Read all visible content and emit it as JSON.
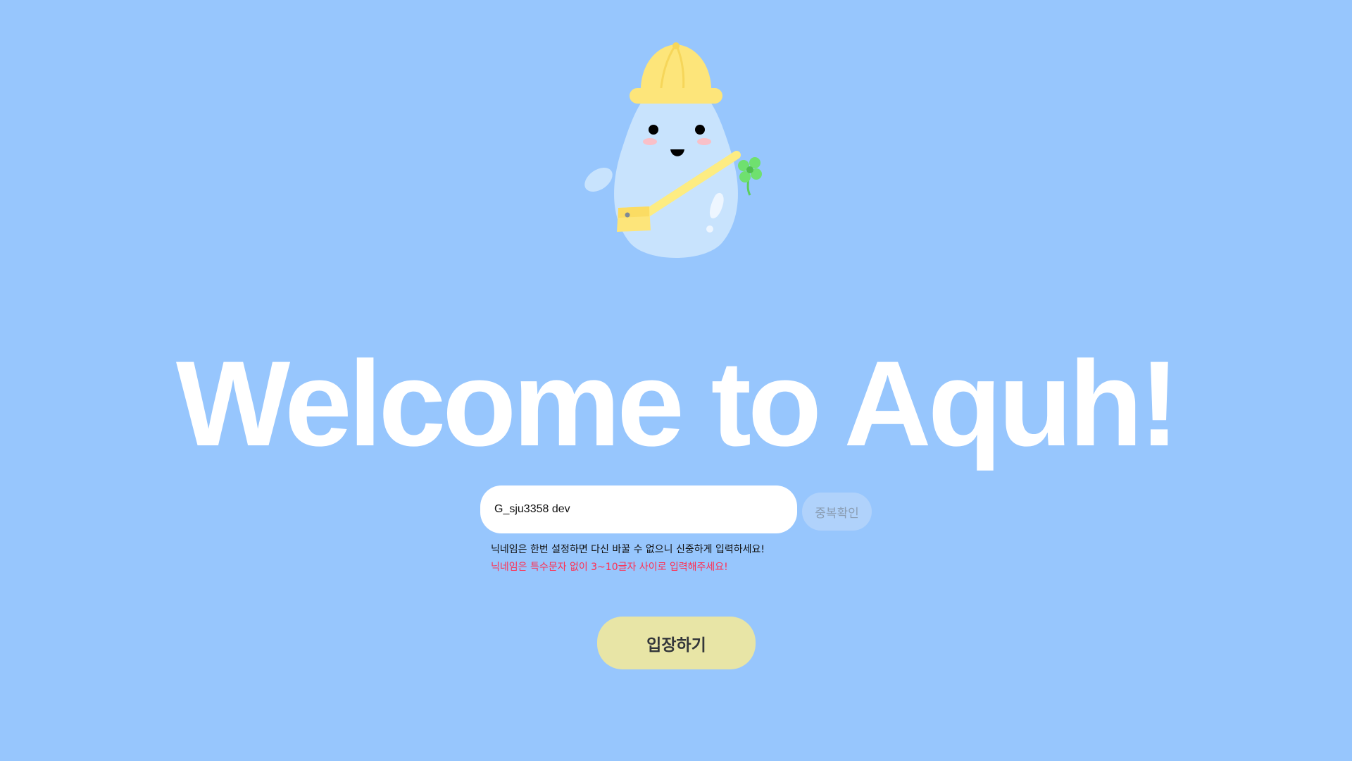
{
  "colors": {
    "background": "#97c6fd",
    "title": "#ffffff",
    "input_bg": "#ffffff",
    "check_button_bg": "#b0d2fb",
    "check_button_text": "#8a9db3",
    "error_text": "#ff2f52",
    "enter_button_bg": "#e8e5a6",
    "enter_button_text": "#33363a"
  },
  "mascot": {
    "icon": "water-drop-mascot-icon",
    "hat_icon": "yellow-hat-icon",
    "bag_icon": "crossbody-bag-icon",
    "clover_icon": "four-leaf-clover-icon"
  },
  "header": {
    "title": "Welcome to Aquh!"
  },
  "form": {
    "nickname_value": "G_sju3358 dev",
    "check_duplicate_label": "중복확인",
    "hint_text": "닉네임은 한번 설정하면 다신 바꿀 수 없으니 신중하게 입력하세요!",
    "error_text": "닉네임은 특수문자 없이 3~10글자 사이로 입력해주세요!",
    "enter_label": "입장하기"
  }
}
